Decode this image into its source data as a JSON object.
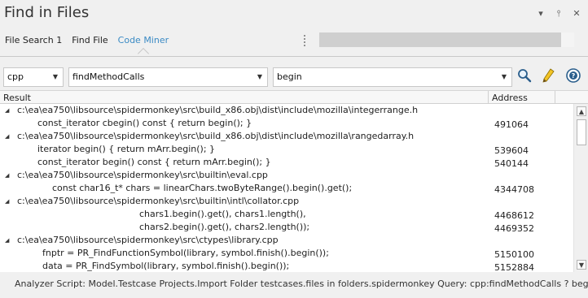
{
  "window": {
    "title": "Find in Files",
    "controls": {
      "menu": "▾",
      "pin": "⫯",
      "close": "✕"
    }
  },
  "tabs": [
    {
      "label": "File Search 1",
      "active": false
    },
    {
      "label": "Find File",
      "active": false
    },
    {
      "label": "Code Miner",
      "active": true
    }
  ],
  "progress": {
    "value_fraction": 0.95
  },
  "toolbar": {
    "language": "cpp",
    "query": "findMethodCalls",
    "argument": "begin",
    "icons": [
      "search-icon",
      "edit-pencil-icon",
      "help-icon"
    ]
  },
  "grid": {
    "columns": {
      "result": "Result",
      "address": "Address"
    },
    "rows": [
      {
        "type": "group",
        "text": "c:\\ea\\ea750\\libsource\\spidermonkey\\src\\build_x86.obj\\dist\\include\\mozilla\\integerrange.h",
        "address": ""
      },
      {
        "type": "item",
        "text": "const_iterator cbegin() const { return begin(); }",
        "address": "491064"
      },
      {
        "type": "group",
        "text": "c:\\ea\\ea750\\libsource\\spidermonkey\\src\\build_x86.obj\\dist\\include\\mozilla\\rangedarray.h",
        "address": ""
      },
      {
        "type": "item",
        "text": "iterator begin() { return mArr.begin(); }",
        "address": "539604"
      },
      {
        "type": "item",
        "text": "const_iterator begin() const { return mArr.begin(); }",
        "address": "540144"
      },
      {
        "type": "group",
        "text": "c:\\ea\\ea750\\libsource\\spidermonkey\\src\\builtin\\eval.cpp",
        "address": ""
      },
      {
        "type": "item",
        "text": "const char16_t* chars = linearChars.twoByteRange().begin().get();",
        "address": "4344708"
      },
      {
        "type": "group",
        "text": "c:\\ea\\ea750\\libsource\\spidermonkey\\src\\builtin\\intl\\collator.cpp",
        "address": ""
      },
      {
        "type": "item",
        "text": "chars1.begin().get(), chars1.length(),",
        "address": "4468612"
      },
      {
        "type": "item",
        "text": "chars2.begin().get(), chars2.length());",
        "address": "4469352"
      },
      {
        "type": "group",
        "text": "c:\\ea\\ea750\\libsource\\spidermonkey\\src\\ctypes\\library.cpp",
        "address": ""
      },
      {
        "type": "item",
        "text": "fnptr = PR_FindFunctionSymbol(library, symbol.finish().begin());",
        "address": "5150100"
      },
      {
        "type": "item",
        "text": "data = PR_FindSymbol(library, symbol.finish().begin());",
        "address": "5152884"
      }
    ]
  },
  "scrollbar": {
    "up": "▲",
    "down": "▼"
  },
  "status": "Analyzer Script: Model.Testcase Projects.Import Folder testcases.files in folders.spidermonkey  Query: cpp:findMethodCalls ? begin"
}
